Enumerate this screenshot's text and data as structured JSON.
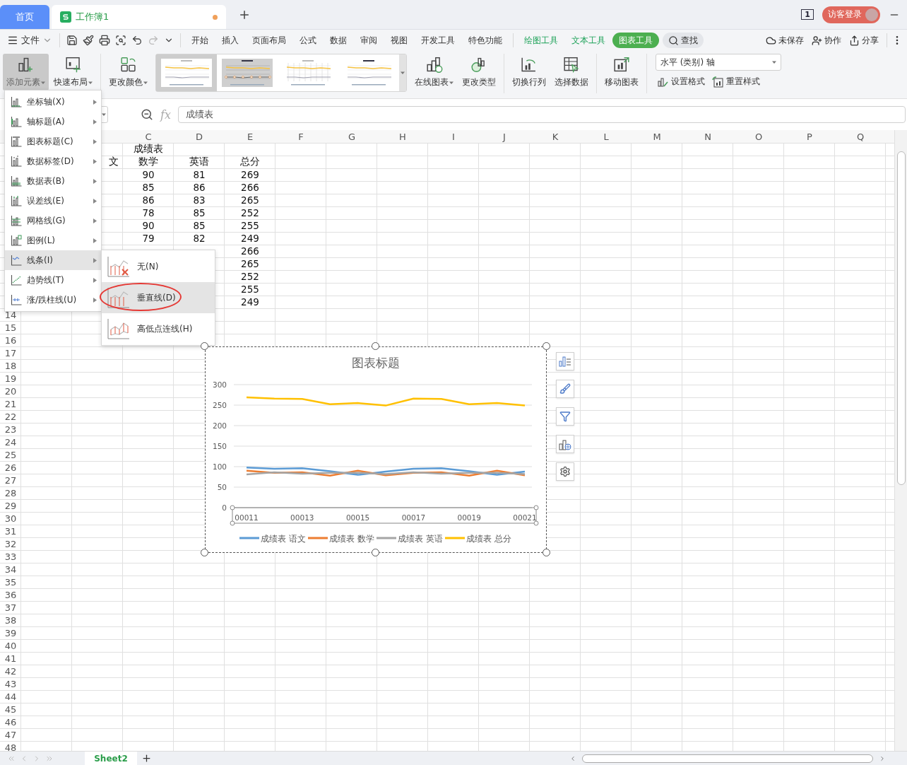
{
  "tabs": [
    {
      "kind": "home",
      "label": "首页",
      "selected": false
    },
    {
      "kind": "document",
      "label": "工作簿1",
      "selected": true,
      "unsaved": true
    }
  ],
  "window_count": "1",
  "login": "访客登录",
  "menu_bar": {
    "file": "文件",
    "tabs": [
      {
        "kind": "main",
        "label": "开始",
        "selected": false
      },
      {
        "kind": "main",
        "label": "插入",
        "selected": false
      },
      {
        "kind": "main",
        "label": "页面布局",
        "selected": false
      },
      {
        "kind": "main",
        "label": "公式",
        "selected": false
      },
      {
        "kind": "main",
        "label": "数据",
        "selected": false
      },
      {
        "kind": "main",
        "label": "审阅",
        "selected": false
      },
      {
        "kind": "main",
        "label": "视图",
        "selected": false
      },
      {
        "kind": "main",
        "label": "开发工具",
        "selected": false
      },
      {
        "kind": "main",
        "label": "特色功能",
        "selected": false
      },
      {
        "kind": "tool",
        "label": "绘图工具",
        "selected": false
      },
      {
        "kind": "tool",
        "label": "文本工具",
        "selected": false
      },
      {
        "kind": "tool",
        "label": "图表工具",
        "selected": true
      }
    ],
    "search": "查找",
    "actions": [
      "未保存",
      "协作",
      "分享"
    ]
  },
  "ribbon": [
    {
      "kind": "button",
      "label": "添加元素",
      "dropdown": true,
      "pressed": true
    },
    {
      "kind": "button",
      "label": "快速布局",
      "dropdown": true,
      "pressed": false
    },
    {
      "kind": "separator"
    },
    {
      "kind": "button",
      "label": "更改颜色",
      "dropdown": true,
      "pressed": false
    },
    {
      "kind": "gallery",
      "styles": [
        {
          "kind": "light",
          "selected": true
        },
        {
          "kind": "gray",
          "selected": false
        },
        {
          "kind": "grid",
          "selected": false
        },
        {
          "kind": "plain",
          "selected": false
        }
      ]
    },
    {
      "kind": "button",
      "label": "在线图表",
      "dropdown": true,
      "pressed": false
    },
    {
      "kind": "button",
      "label": "更改类型",
      "dropdown": false,
      "pressed": false
    },
    {
      "kind": "separator"
    },
    {
      "kind": "button",
      "label": "切换行列",
      "dropdown": false,
      "pressed": false
    },
    {
      "kind": "button",
      "label": "选择数据",
      "dropdown": false,
      "pressed": false
    },
    {
      "kind": "separator"
    },
    {
      "kind": "button",
      "label": "移动图表",
      "dropdown": false,
      "pressed": false
    },
    {
      "kind": "separator"
    },
    {
      "kind": "format",
      "select": "水平 (类别) 轴",
      "buttons": [
        "设置格式",
        "重置样式"
      ]
    }
  ],
  "formula_bar": {
    "function_label": "fx",
    "value": "成绩表"
  },
  "sheet": {
    "columns": [
      {
        "kind": "covered"
      },
      {
        "kind": "covered"
      },
      {
        "kind": "header",
        "label": "C"
      },
      {
        "kind": "header",
        "label": "D"
      },
      {
        "kind": "header",
        "label": "E"
      },
      {
        "kind": "header",
        "label": "F"
      },
      {
        "kind": "header",
        "label": "G"
      },
      {
        "kind": "header",
        "label": "H"
      },
      {
        "kind": "header",
        "label": "I"
      },
      {
        "kind": "header",
        "label": "J"
      },
      {
        "kind": "header",
        "label": "K"
      },
      {
        "kind": "header",
        "label": "L"
      },
      {
        "kind": "header",
        "label": "M"
      },
      {
        "kind": "header",
        "label": "N"
      },
      {
        "kind": "header",
        "label": "O"
      },
      {
        "kind": "header",
        "label": "P"
      },
      {
        "kind": "header",
        "label": "Q"
      }
    ],
    "rows": [
      {
        "cells": [
          null,
          null,
          "成绩表"
        ]
      },
      {
        "cells": [
          null,
          "文",
          "数学",
          "英语",
          "总分"
        ]
      },
      {
        "cells": [
          null,
          null,
          "90",
          "81",
          "269"
        ]
      },
      {
        "cells": [
          null,
          null,
          "85",
          "86",
          "266"
        ]
      },
      {
        "cells": [
          null,
          null,
          "86",
          "83",
          "265"
        ]
      },
      {
        "cells": [
          null,
          null,
          "78",
          "85",
          "252"
        ]
      },
      {
        "cells": [
          null,
          null,
          "90",
          "85",
          "255"
        ]
      },
      {
        "cells": [
          null,
          null,
          "79",
          "82",
          "249"
        ]
      },
      {
        "cells": [
          null,
          null,
          null,
          null,
          "266"
        ]
      },
      {
        "cells": [
          null,
          null,
          null,
          null,
          "265"
        ]
      },
      {
        "cells": [
          null,
          null,
          null,
          null,
          "252"
        ]
      },
      {
        "cells": [
          null,
          null,
          null,
          null,
          "255"
        ]
      },
      {
        "cells": [
          null,
          null,
          null,
          null,
          "249"
        ]
      },
      {
        "number": "14"
      },
      {
        "number": "15"
      },
      {
        "number": "16"
      },
      {
        "number": "17"
      },
      {
        "number": "18"
      },
      {
        "number": "19"
      },
      {
        "number": "20"
      },
      {
        "number": "21"
      },
      {
        "number": "22"
      },
      {
        "number": "23"
      },
      {
        "number": "24"
      },
      {
        "number": "25"
      },
      {
        "number": "26"
      },
      {
        "number": "27"
      },
      {
        "number": "28"
      },
      {
        "number": "29"
      },
      {
        "number": "30"
      },
      {
        "number": "31"
      },
      {
        "number": "32"
      },
      {
        "number": "33"
      },
      {
        "number": "34"
      },
      {
        "number": "35"
      },
      {
        "number": "36"
      },
      {
        "number": "37"
      },
      {
        "number": "38"
      },
      {
        "number": "39"
      },
      {
        "number": "40"
      },
      {
        "number": "41"
      },
      {
        "number": "42"
      },
      {
        "number": "43"
      },
      {
        "number": "44"
      },
      {
        "number": "45"
      },
      {
        "number": "46"
      },
      {
        "number": "47"
      },
      {
        "number": "48"
      }
    ]
  },
  "add_element_menu": {
    "items": [
      {
        "label": "坐标轴(X)",
        "selected": false
      },
      {
        "label": "轴标题(A)",
        "selected": false
      },
      {
        "label": "图表标题(C)",
        "selected": false
      },
      {
        "label": "数据标签(D)",
        "selected": false
      },
      {
        "label": "数据表(B)",
        "selected": false
      },
      {
        "label": "误差线(E)",
        "selected": false
      },
      {
        "label": "网格线(G)",
        "selected": false
      },
      {
        "label": "图例(L)",
        "selected": false
      },
      {
        "label": "线条(I)",
        "selected": true
      },
      {
        "label": "趋势线(T)",
        "selected": false
      },
      {
        "label": "涨/跌柱线(U)",
        "selected": false
      }
    ]
  },
  "lines_submenu": {
    "items": [
      {
        "kind": "none",
        "label": "无(N)",
        "selected": false
      },
      {
        "kind": "vertical",
        "label": "垂直线(D)",
        "selected": true
      },
      {
        "kind": "high-low",
        "label": "高低点连线(H)",
        "selected": false
      }
    ]
  },
  "chart": {
    "chart_data": {
      "type": "line",
      "title": "图表标题",
      "categories": [
        "00011",
        null,
        "00013",
        null,
        "00015",
        null,
        "00017",
        null,
        "00019",
        null,
        "00021"
      ],
      "ylim": [
        0,
        300
      ],
      "yticks": [
        0,
        50,
        100,
        150,
        200,
        250,
        300
      ],
      "grid": true,
      "legend": true,
      "series": [
        {
          "name": "成绩表 语文",
          "color": "#5b9bd5",
          "values": [
            98,
            95,
            96,
            89,
            80,
            88,
            95,
            96,
            89,
            80,
            88
          ]
        },
        {
          "name": "成绩表 数学",
          "color": "#ed7d31",
          "values": [
            90,
            85,
            86,
            78,
            90,
            79,
            85,
            86,
            78,
            90,
            79
          ]
        },
        {
          "name": "成绩表 英语",
          "color": "#a5a5a5",
          "values": [
            81,
            86,
            83,
            85,
            85,
            82,
            86,
            83,
            85,
            85,
            82
          ]
        },
        {
          "name": "成绩表 总分",
          "color": "#ffc000",
          "values": [
            269,
            266,
            265,
            252,
            255,
            249,
            266,
            265,
            252,
            255,
            249
          ]
        }
      ]
    }
  },
  "sheet_tabs": [
    {
      "label": "Sheet2",
      "selected": true
    }
  ]
}
